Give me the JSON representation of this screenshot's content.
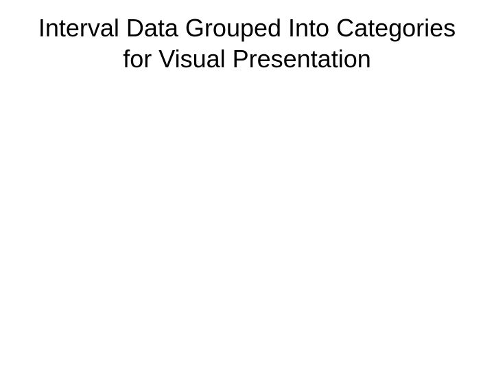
{
  "slide": {
    "title": "Interval Data Grouped Into Categories for Visual Presentation"
  }
}
